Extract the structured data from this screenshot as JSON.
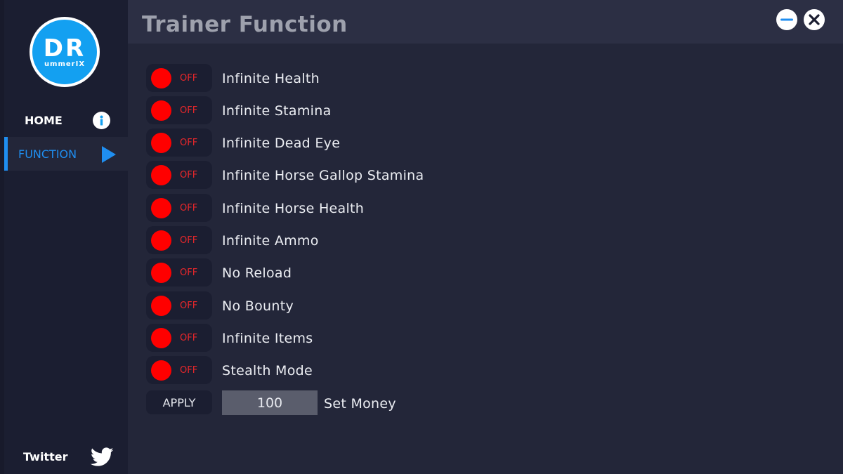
{
  "sidebar": {
    "logo": {
      "main": "DR",
      "sub": "ummerIX"
    },
    "nav": [
      {
        "label": "HOME",
        "icon": "info-icon"
      },
      {
        "label": "FUNCTION",
        "icon": "play-icon",
        "active": true
      }
    ],
    "social": {
      "label": "Twitter",
      "icon": "twitter-icon"
    }
  },
  "header": {
    "title": "Trainer Function",
    "controls": [
      "minimize-icon",
      "close-icon"
    ]
  },
  "functions": [
    {
      "label": "Infinite Health",
      "state": "OFF"
    },
    {
      "label": "Infinite Stamina",
      "state": "OFF"
    },
    {
      "label": "Infinite Dead Eye",
      "state": "OFF"
    },
    {
      "label": "Infinite Horse Gallop Stamina",
      "state": "OFF"
    },
    {
      "label": "Infinite Horse Health",
      "state": "OFF"
    },
    {
      "label": "Infinite Ammo",
      "state": "OFF"
    },
    {
      "label": "No Reload",
      "state": "OFF"
    },
    {
      "label": "No Bounty",
      "state": "OFF"
    },
    {
      "label": "Infinite Items",
      "state": "OFF"
    },
    {
      "label": "Stealth Mode",
      "state": "OFF"
    }
  ],
  "money": {
    "apply_label": "APPLY",
    "value": "100",
    "label": "Set Money"
  },
  "colors": {
    "background": "#232639",
    "sidebar": "#1b1e31",
    "accent": "#1f8ef0",
    "off_knob": "#ff0000",
    "off_text": "#e8272b",
    "logo": "#13a0f1"
  }
}
